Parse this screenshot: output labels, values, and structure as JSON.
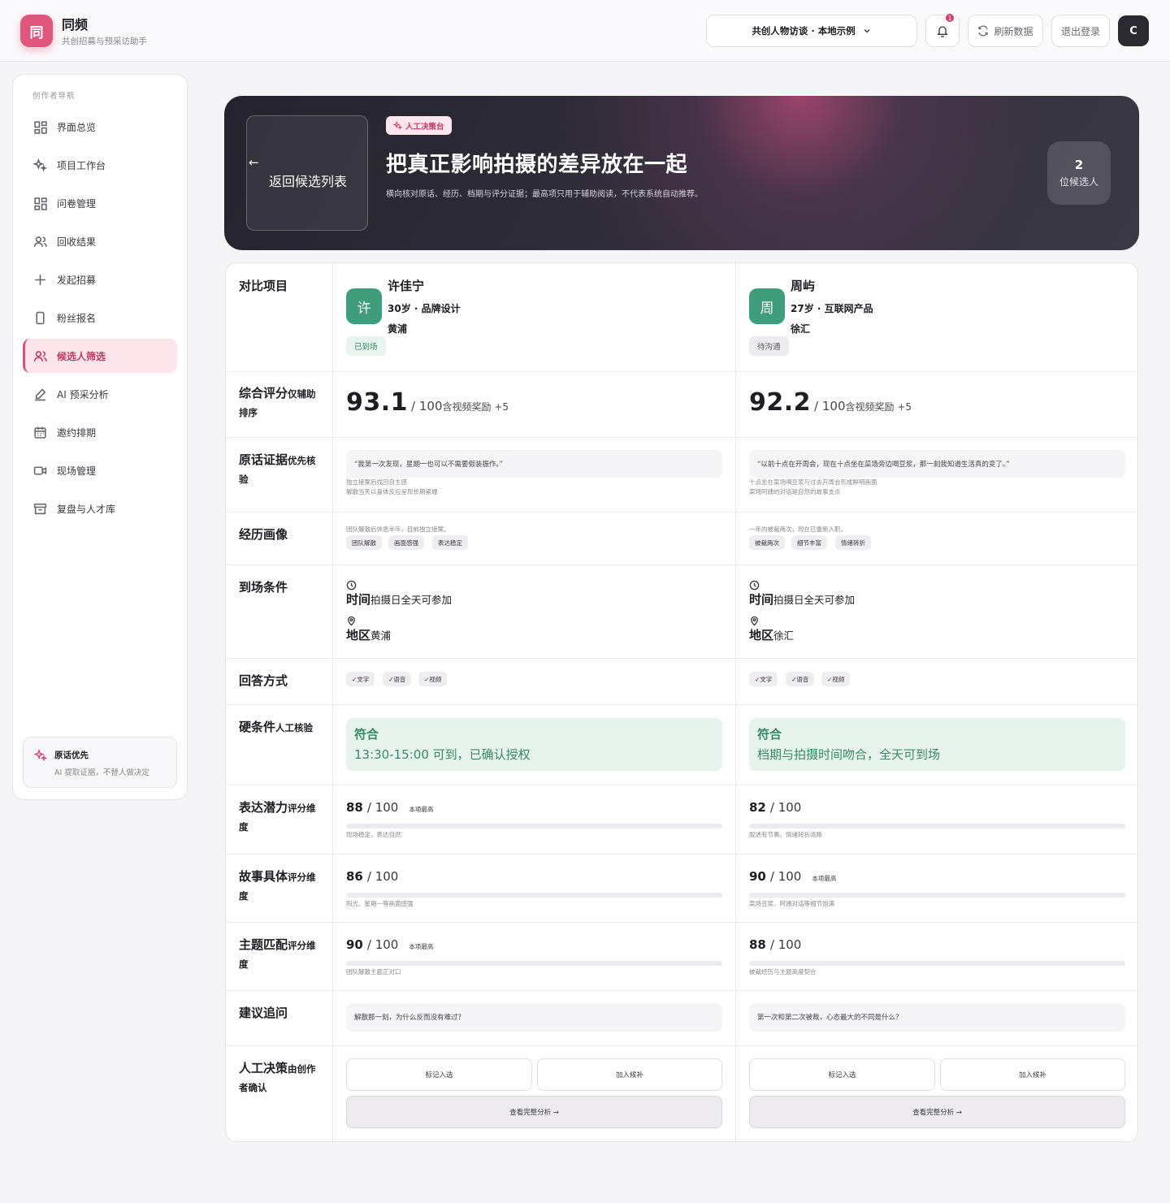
{
  "app": {
    "logo_char": "同",
    "name": "同频",
    "subtitle": "共创招募与预采访助手"
  },
  "topbar": {
    "project": "共创人物访谈 · 本地示例",
    "notif_count": "1",
    "refresh": "刷新数据",
    "logout": "退出登录",
    "user_initial": "C"
  },
  "sidebar": {
    "heading": "创作者导航",
    "items": [
      {
        "label": "界面总览",
        "icon": "grid-icon"
      },
      {
        "label": "项目工作台",
        "icon": "sparkle-icon"
      },
      {
        "label": "问卷管理",
        "icon": "grid-icon"
      },
      {
        "label": "回收结果",
        "icon": "users-icon"
      },
      {
        "label": "发起招募",
        "icon": "plus-icon"
      },
      {
        "label": "粉丝报名",
        "icon": "phone-icon"
      },
      {
        "label": "候选人筛选",
        "icon": "users-icon",
        "active": true
      },
      {
        "label": "AI 预采分析",
        "icon": "pen-icon"
      },
      {
        "label": "邀约排期",
        "icon": "calendar-icon"
      },
      {
        "label": "现场管理",
        "icon": "video-icon"
      },
      {
        "label": "复盘与人才库",
        "icon": "archive-icon"
      }
    ],
    "footer": {
      "title": "原话优先",
      "text": "AI 提取证据，不替人做决定"
    }
  },
  "hero": {
    "back_label": "返回候选列表",
    "tag": "人工决策台",
    "title": "把真正影响拍摄的差异放在一起",
    "desc": "横向核对原话、经历、档期与评分证据；最高项只用于辅助阅读，不代表系统自动推荐。",
    "count": "2",
    "count_unit": "位候选人"
  },
  "rows": {
    "project": "对比项目",
    "score": {
      "main": "综合评分",
      "sub": "仅辅助排序"
    },
    "quote": {
      "main": "原话证据",
      "sub": "优先核验"
    },
    "exp": "经历画像",
    "attend": "到场条件",
    "answer": "回答方式",
    "hard": {
      "main": "硬条件",
      "sub": "人工核验"
    },
    "d1": {
      "main": "表达潜力",
      "sub": "评分维度"
    },
    "d2": {
      "main": "故事具体",
      "sub": "评分维度"
    },
    "d3": {
      "main": "主题匹配",
      "sub": "评分维度"
    },
    "follow": "建议追问",
    "decide": {
      "main": "人工决策",
      "sub": "由创作者确认"
    }
  },
  "labels": {
    "time": "时间",
    "area": "地区",
    "best": "本项最高",
    "ok": "符合",
    "out_of": "/ 100",
    "mark": "标记入选",
    "standby": "加入候补",
    "full": "查看完整分析 →"
  },
  "candidates": [
    {
      "avatar": "许",
      "name": "许佳宁",
      "info": "30岁 · 品牌设计",
      "district": "黄浦",
      "status": "已到场",
      "score": "93.1",
      "score_rest": "/ 100",
      "bonus": "含视频奖励 +5",
      "quote": "“我第一次发现，星期一也可以不需要假装振作。”",
      "quote_notes": [
        "独立接案后找回自主感",
        "解散当天以身体反应呈现长期紧绷"
      ],
      "exp_note": "团队解散后休息半年，目前独立接案。",
      "exp_tags": [
        "团队解散",
        "画面感强",
        "表达稳定"
      ],
      "time": "拍摄日全天可参加",
      "area": "黄浦",
      "answer": [
        "✓文字",
        "✓语音",
        "✓视频"
      ],
      "hard": "13:30-15:00 可到，已确认授权",
      "dims": [
        {
          "score": "88",
          "best": true,
          "note": "现场稳定，表达自然"
        },
        {
          "score": "86",
          "best": false,
          "note": "阳光、星期一等画面感强"
        },
        {
          "score": "90",
          "best": true,
          "note": "团队解散主题正对口"
        }
      ],
      "follow": "解散那一刻，为什么反而没有难过？"
    },
    {
      "avatar": "周",
      "name": "周屿",
      "info": "27岁 · 互联网产品",
      "district": "徐汇",
      "status": "待沟通",
      "score": "92.2",
      "score_rest": "/ 100",
      "bonus": "含视频奖励 +5",
      "quote": "“以前十点在开周会，现在十点坐在菜场旁边喝豆浆，那一刻我知道生活真的变了。”",
      "quote_notes": [
        "十点坐在菜场喝豆浆与过去开周会形成鲜明画面",
        "菜场阿姨的对话是自然的故事支点"
      ],
      "exp_note": "一年内被裁两次，现在已重新入职。",
      "exp_tags": [
        "被裁两次",
        "细节丰富",
        "情绪转折"
      ],
      "time": "拍摄日全天可参加",
      "area": "徐汇",
      "answer": [
        "✓文字",
        "✓语音",
        "✓视频"
      ],
      "hard": "档期与拍摄时间吻合，全天可到场",
      "dims": [
        {
          "score": "82",
          "best": false,
          "note": "叙述有节奏，情绪转折清晰"
        },
        {
          "score": "90",
          "best": true,
          "note": "菜场豆浆、阿姨对话等细节饱满"
        },
        {
          "score": "88",
          "best": false,
          "note": "被裁经历与主题高度契合"
        }
      ],
      "follow": "第一次和第二次被裁，心态最大的不同是什么？"
    }
  ]
}
